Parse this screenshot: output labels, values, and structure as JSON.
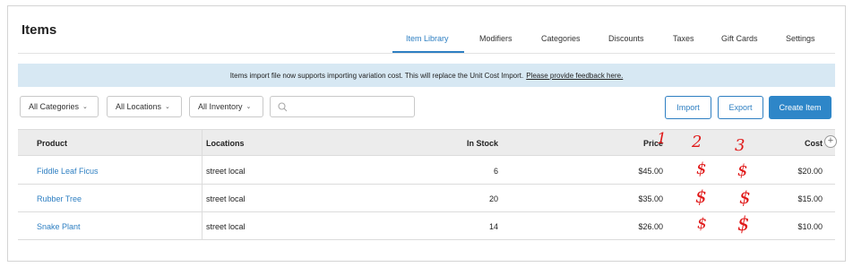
{
  "header": {
    "title": "Items"
  },
  "tabs": [
    {
      "label": "Item Library",
      "active": true
    },
    {
      "label": "Modifiers",
      "active": false
    },
    {
      "label": "Categories",
      "active": false
    },
    {
      "label": "Discounts",
      "active": false
    },
    {
      "label": "Taxes",
      "active": false
    },
    {
      "label": "Gift Cards",
      "active": false
    },
    {
      "label": "Settings",
      "active": false
    }
  ],
  "banner": {
    "text": "Items import file now supports importing variation cost. This will replace the Unit Cost Import.",
    "link": "Please provide feedback here."
  },
  "filters": {
    "categories": "All Categories",
    "locations": "All Locations",
    "inventory": "All Inventory",
    "search_value": "",
    "search_placeholder": ""
  },
  "actions": {
    "import": "Import",
    "export": "Export",
    "create": "Create Item"
  },
  "table": {
    "columns": {
      "product": "Product",
      "locations": "Locations",
      "in_stock": "In Stock",
      "price": "Price",
      "cost": "Cost"
    },
    "rows": [
      {
        "product": "Fiddle Leaf Ficus",
        "location": "street local",
        "in_stock": "6",
        "price": "$45.00",
        "cost": "$20.00"
      },
      {
        "product": "Rubber Tree",
        "location": "street local",
        "in_stock": "20",
        "price": "$35.00",
        "cost": "$15.00"
      },
      {
        "product": "Snake Plant",
        "location": "street local",
        "in_stock": "14",
        "price": "$26.00",
        "cost": "$10.00"
      }
    ]
  },
  "annotations": {
    "numbers": [
      "1",
      "2",
      "3"
    ],
    "dollar": "$"
  },
  "colors": {
    "accent": "#2e7fc2",
    "banner_bg": "#d7e8f3",
    "annotation": "#e01818",
    "header_bg": "#ececec"
  },
  "icons": {
    "search": "search-icon",
    "add_column": "plus-circle-icon",
    "dropdown": "chevron-down-icon"
  }
}
